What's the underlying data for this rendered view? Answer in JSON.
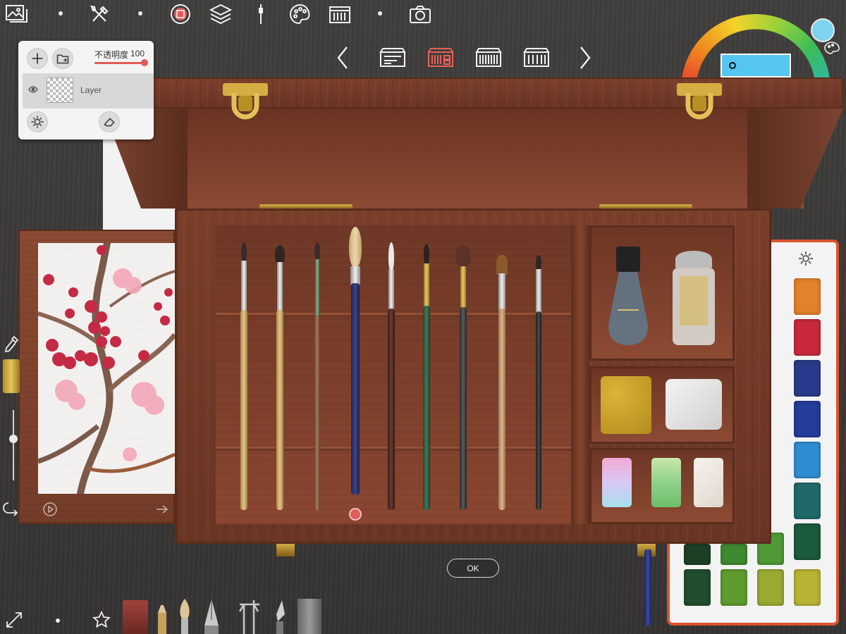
{
  "layer_panel": {
    "opacity_label": "不透明度",
    "opacity_value": "100",
    "layer_name": "Layer"
  },
  "dialog": {
    "ok_label": "OK"
  },
  "colors": {
    "current": "#54c6f0",
    "accent": "#e05a5a",
    "palette_border": "#d9542f"
  },
  "toolbar_icons": [
    "gallery-icon",
    "tools-icon",
    "record-icon",
    "layers-icon",
    "brush-icon",
    "palette-icon",
    "brush-box-icon",
    "camera-icon"
  ],
  "bottom_tools": [
    "fullscreen-icon",
    "favorite-star-icon",
    "eraser-tool-icon",
    "pencil-tool-icon",
    "brush-tool-icon",
    "pen-nib-tool-icon",
    "caliper-tool-icon",
    "knife-tool-icon",
    "sharpener-tool-icon"
  ]
}
